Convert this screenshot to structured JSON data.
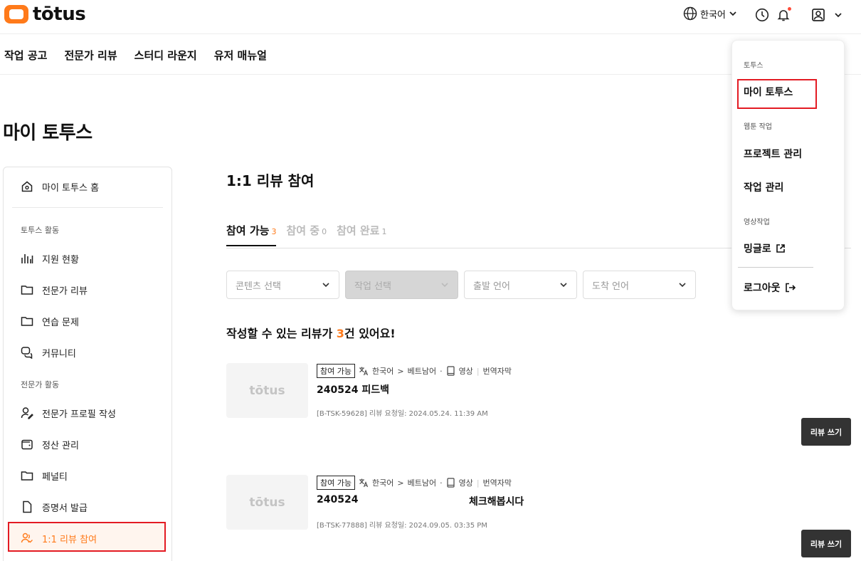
{
  "brand": {
    "logo_text": "tōtus",
    "accent": "#ff7a1a",
    "highlight": "#e31b23"
  },
  "header": {
    "language": "한국어",
    "icons": [
      "globe-icon",
      "clock-icon",
      "bell-icon",
      "user-icon"
    ]
  },
  "nav": {
    "items": [
      "작업 공고",
      "전문가 리뷰",
      "스터디 라운지",
      "유저 매뉴얼"
    ]
  },
  "page_title": "마이 토투스",
  "sidebar": {
    "home": "마이 토투스 홈",
    "section_activity": "토투스 활동",
    "activity_items": [
      "지원 현황",
      "전문가 리뷰",
      "연습 문제",
      "커뮤니티"
    ],
    "section_expert": "전문가 활동",
    "expert_items": [
      "전문가 프로필 작성",
      "정산 관리",
      "페널티",
      "증명서 발급",
      "1:1 리뷰 참여"
    ]
  },
  "main": {
    "title": "1:1 리뷰 참여",
    "tabs": [
      {
        "label": "참여 가능",
        "count": "3"
      },
      {
        "label": "참여 중",
        "count": "0"
      },
      {
        "label": "참여 완료",
        "count": "1"
      }
    ],
    "filters": [
      "콘텐츠 선택",
      "작업 선택",
      "출발 언어",
      "도착 언어"
    ],
    "count_prefix": "작성할 수 있는 리뷰가 ",
    "count_num": "3",
    "count_suffix": "건 있어요!",
    "cards": [
      {
        "thumb": "tōtus",
        "badge": "참여 가능",
        "source_lang": "한국어",
        "arrow": ">",
        "target_lang": "베트남어",
        "bullet": "·",
        "type": "영상",
        "subtype": "번역자막",
        "title": "240524 피드백",
        "title_extra": "",
        "id_line": "[B-TSK-59628] 리뷰 요청일: 2024.05.24. 11:39 AM",
        "button": "리뷰 쓰기"
      },
      {
        "thumb": "tōtus",
        "badge": "참여 가능",
        "source_lang": "한국어",
        "arrow": ">",
        "target_lang": "베트남어",
        "bullet": "·",
        "type": "영상",
        "subtype": "번역자막",
        "title": "240524",
        "title_extra": "체크해봅시다",
        "id_line": "[B-TSK-77888] 리뷰 요청일: 2024.09.05. 03:35 PM",
        "button": "리뷰 쓰기"
      }
    ]
  },
  "dropdown": {
    "section_totus": "토투스",
    "my_totus": "마이 토투스",
    "section_webtoon": "웹툰 작업",
    "project_manage": "프로젝트 관리",
    "task_manage": "작업 관리",
    "section_video": "영상작업",
    "minglo": "밍글로",
    "logout": "로그아웃"
  }
}
